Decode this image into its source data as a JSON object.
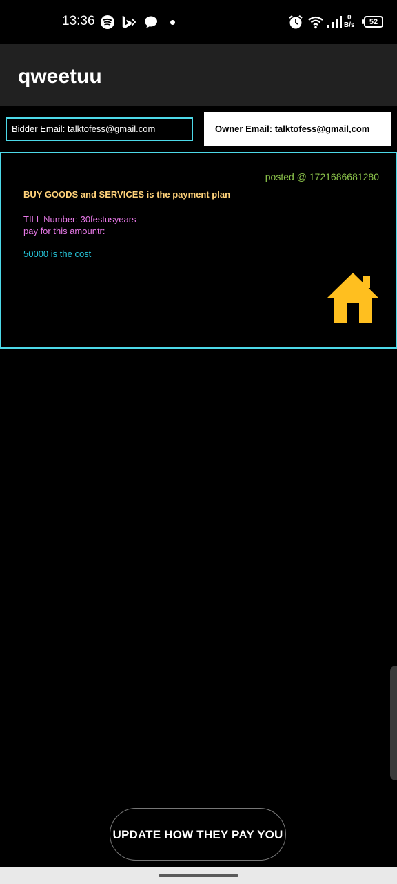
{
  "status_bar": {
    "time": "13:36",
    "net_speed_value": "0",
    "net_speed_unit": "B/s",
    "battery": "52",
    "icons": [
      "spotify-icon",
      "bing-icon",
      "chat-icon",
      "alarm-icon",
      "wifi-icon",
      "signal-icon"
    ]
  },
  "app_bar": {
    "title": "qweetuu"
  },
  "emails": {
    "bidder": "Bidder Email: talktofess@gmail.com",
    "owner": "Owner Email: talktofess@gmail,com"
  },
  "card": {
    "posted": "posted @ 1721686681280",
    "plan": "BUY GOODS and SERVICES is the payment plan",
    "till_line1": "TILL Number: 30festusyears",
    "till_line2": "pay for this amountr:",
    "cost": "50000 is the cost",
    "icon": "home-icon",
    "accent_border": "#4dd9e8",
    "icon_color": "#ffbf1f"
  },
  "update_button": {
    "label": "UPDATE HOW THEY PAY YOU"
  }
}
